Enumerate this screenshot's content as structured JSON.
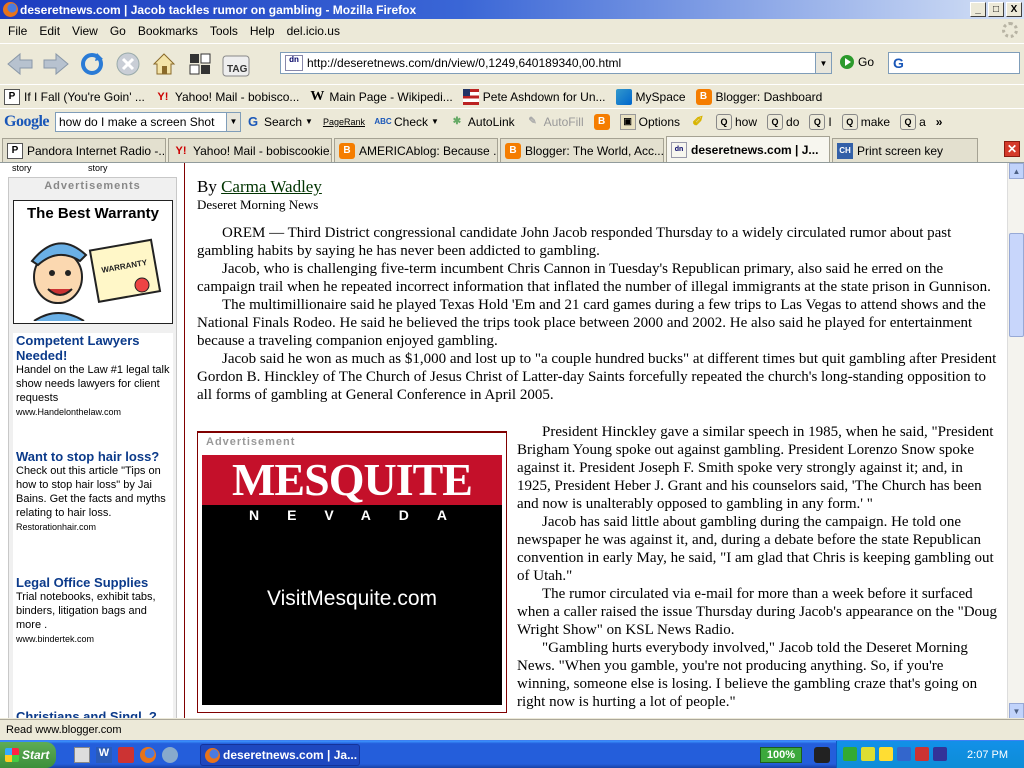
{
  "window": {
    "title": "deseretnews.com | Jacob tackles rumor on gambling - Mozilla Firefox",
    "buttons": {
      "minimize": "_",
      "maximize": "□",
      "close": "X"
    }
  },
  "menu": [
    "File",
    "Edit",
    "View",
    "Go",
    "Bookmarks",
    "Tools",
    "Help",
    "del.icio.us"
  ],
  "nav": {
    "url": "http://deseretnews.com/dn/view/0,1249,640189340,00.html",
    "go_label": "Go",
    "tag_label": "TAG",
    "site_icon": "dn"
  },
  "bookmarks": [
    {
      "icon": "P",
      "label": "If I Fall (You're Goin' ..."
    },
    {
      "icon": "Y!",
      "label": "Yahoo! Mail - bobisco..."
    },
    {
      "icon": "W",
      "label": "Main Page - Wikipedi..."
    },
    {
      "icon": "",
      "label": "Pete Ashdown for Un..."
    },
    {
      "icon": "",
      "label": "MySpace"
    },
    {
      "icon": "B",
      "label": "Blogger: Dashboard"
    }
  ],
  "google_toolbar": {
    "logo": "Google",
    "query": "how do I make a screen Shot",
    "search_label": "Search",
    "pagerank_label": "PageRank",
    "check_label": "Check",
    "autolink_label": "AutoLink",
    "autofill_label": "AutoFill",
    "options_label": "Options",
    "terms": [
      "how",
      "do",
      "I",
      "make",
      "a"
    ],
    "more": "»"
  },
  "tabs": [
    {
      "icon": "P",
      "label": "Pandora Internet Radio -..."
    },
    {
      "icon": "Y!",
      "label": "Yahoo! Mail - bobiscookie..."
    },
    {
      "icon": "B",
      "label": "AMERICAblog: Because ..."
    },
    {
      "icon": "B",
      "label": "Blogger: The World, Acc..."
    },
    {
      "icon": "dn",
      "label": "deseretnews.com | J..."
    },
    {
      "icon": "CH",
      "label": "Print screen key"
    }
  ],
  "page": {
    "story_labels": [
      "story",
      "story"
    ],
    "sidebar": {
      "header": "Advertisements",
      "warranty_title": "The Best Warranty",
      "warranty_doc": "WARRANTY",
      "ads": [
        {
          "title": "Competent Lawyers Needed!",
          "desc": "Handel on the Law #1 legal talk show needs lawyers for client requests",
          "url": "www.Handelonthelaw.com"
        },
        {
          "title": "Want to stop hair loss?",
          "desc": "Check out this article \"Tips on how to stop hair loss\" by Jai Bains. Get the facts and myths relating to hair loss.",
          "url": "Restorationhair.com"
        },
        {
          "title": "Legal Office Supplies",
          "desc": "Trial notebooks, exhibit tabs, binders, litigation bags and more .",
          "url": "www.bindertek.com"
        },
        {
          "title": "Christians and Singl..?",
          "desc": "",
          "url": ""
        }
      ]
    },
    "article": {
      "by": "By ",
      "author": "Carma Wadley",
      "publication": "Deseret Morning News",
      "paragraphs": [
        "OREM — Third District congressional candidate John Jacob responded Thursday to a widely circulated rumor about past gambling habits by saying he has never been addicted to gambling.",
        "Jacob, who is challenging five-term incumbent Chris Cannon in Tuesday's Republican primary, also said he erred on the campaign trail when he repeated incorrect information that inflated the number of illegal immigrants at the state prison in Gunnison.",
        "The multimillionaire said he played Texas Hold 'Em and 21 card games during a few trips to Las Vegas to attend shows and the National Finals Rodeo. He said he believed the trips took place between 2000 and 2002. He also said he played for entertainment because a traveling companion enjoyed gambling.",
        "Jacob said he won as much as $1,000 and lost up to \"a couple hundred bucks\" at different times but quit gambling after President Gordon B. Hinckley of The Church of Jesus Christ of Latter-day Saints forcefully repeated the church's long-standing opposition to all forms of gambling at General Conference in April 2005."
      ],
      "paragraphs2": [
        "President Hinckley gave a similar speech in 1985, when he said, \"President Brigham Young spoke out against gambling. President Lorenzo Snow spoke against it. President Joseph F. Smith spoke very strongly against it; and, in 1925, President Heber J. Grant and his counselors said, 'The Church has been and now is unalterably opposed to gambling in any form.' \"",
        "Jacob has said little about gambling during the campaign. He told one newspaper he was against it, and, during a debate before the state Republican convention in early May, he said, \"I am glad that Chris is keeping gambling out of Utah.\"",
        "The rumor circulated via e-mail for more than a week before it surfaced when a caller raised the issue Thursday during Jacob's appearance on the \"Doug Wright Show\" on KSL News Radio.",
        "\"Gambling hurts everybody involved,\" Jacob told the Deseret Morning News. \"When you gamble, you're not producing anything. So, if you're winning, someone else is losing. I believe the gambling craze that's going on right now is hurting a lot of people.\""
      ]
    },
    "mesquite_ad": {
      "label": "Advertisement",
      "brand": "MESQUITE",
      "state": "NEVADA",
      "url": "VisitMesquite.com"
    }
  },
  "status": {
    "text": "Read www.blogger.com"
  },
  "taskbar": {
    "start": "Start",
    "task": "deseretnews.com | Ja...",
    "zoom": "100%",
    "clock": "2:07 PM"
  }
}
